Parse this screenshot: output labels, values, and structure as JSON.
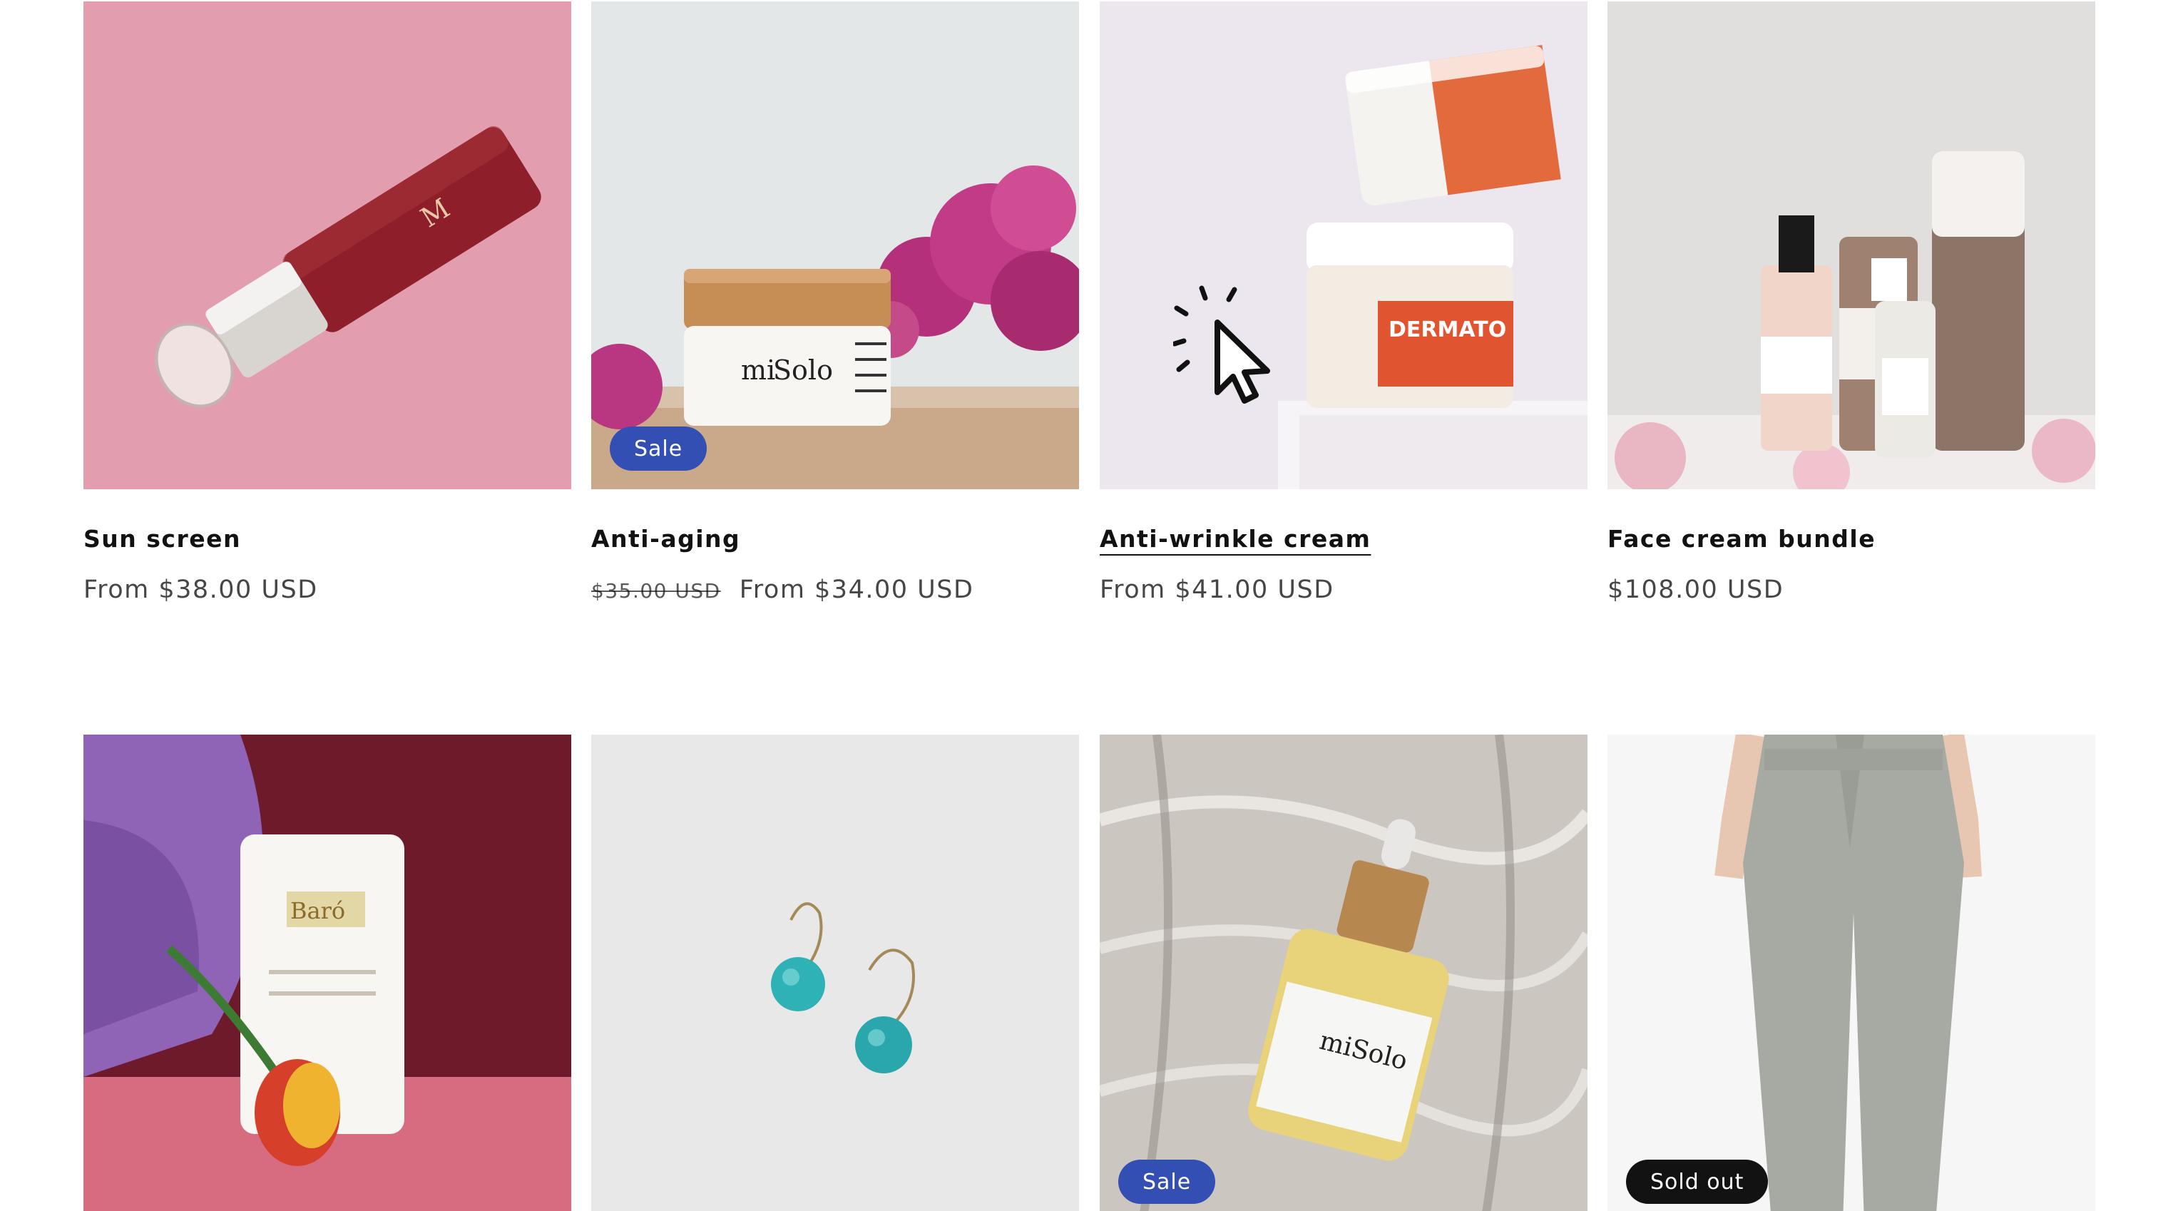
{
  "products_row1": [
    {
      "title": "Sun screen",
      "price": "From $38.00 USD",
      "compare_price": "",
      "badge": ""
    },
    {
      "title": "Anti-aging",
      "price": "From $34.00 USD",
      "compare_price": "$35.00 USD",
      "badge": "Sale"
    },
    {
      "title": "Anti-wrinkle cream",
      "price": "From $41.00 USD",
      "compare_price": "",
      "badge": ""
    },
    {
      "title": "Face cream bundle",
      "price": "$108.00 USD",
      "compare_price": "",
      "badge": ""
    }
  ],
  "products_row2": [
    {
      "badge": ""
    },
    {
      "badge": ""
    },
    {
      "badge": "Sale"
    },
    {
      "badge": "Sold out"
    }
  ],
  "colors": {
    "sale_badge": "#334fb4",
    "sold_badge": "#121212",
    "text": "#121212"
  },
  "icons": {
    "cursor": "click-cursor-icon"
  }
}
